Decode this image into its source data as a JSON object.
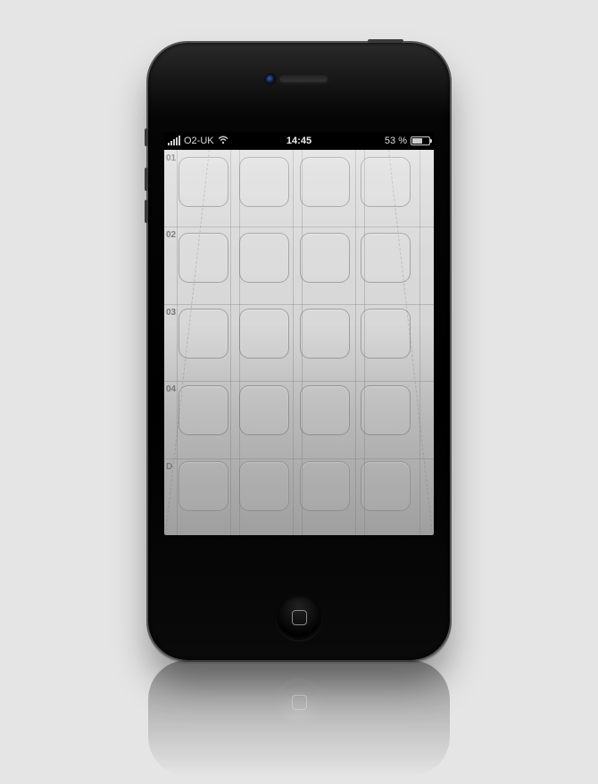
{
  "statusbar": {
    "carrier": "O2-UK",
    "time": "14:45",
    "battery_percent": "53 %"
  },
  "grid": {
    "rows": [
      {
        "label": "01"
      },
      {
        "label": "02"
      },
      {
        "label": "03"
      },
      {
        "label": "04"
      },
      {
        "label": "D"
      }
    ],
    "columns": 4
  }
}
